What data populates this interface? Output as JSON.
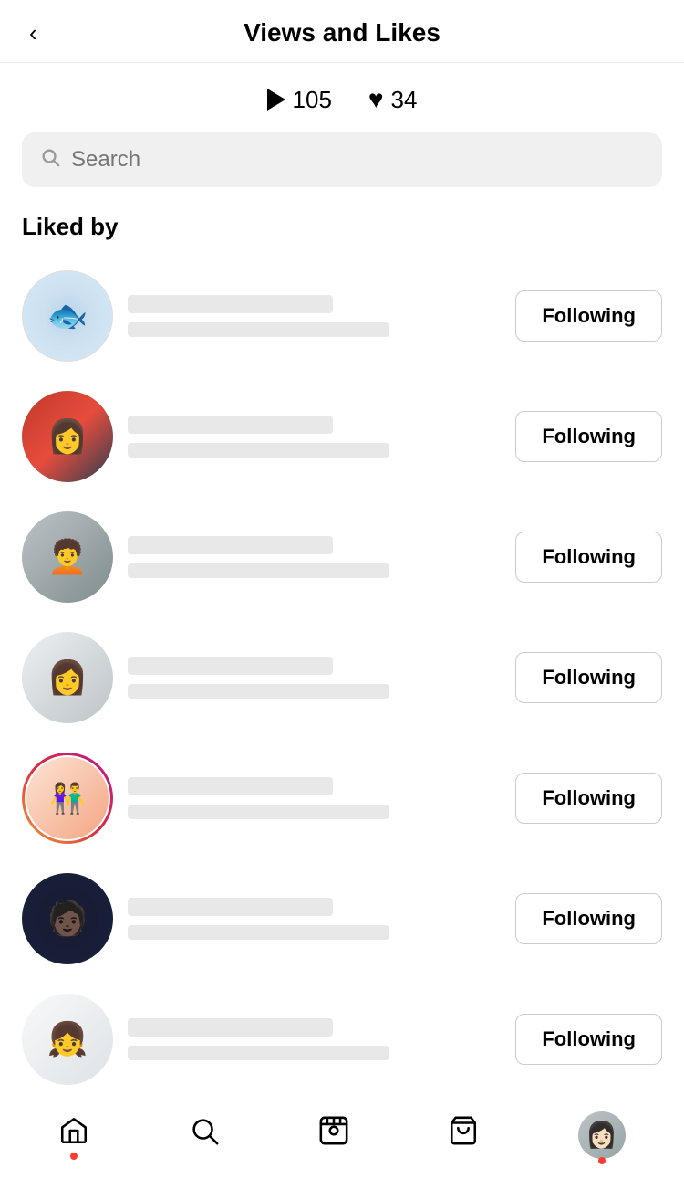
{
  "header": {
    "title": "Views and Likes",
    "back_label": "<"
  },
  "stats": {
    "views_count": "105",
    "likes_count": "34"
  },
  "search": {
    "placeholder": "Search"
  },
  "section": {
    "title": "Liked by"
  },
  "users": [
    {
      "id": 1,
      "following_label": "Following",
      "avatar_type": "fish",
      "has_story": false
    },
    {
      "id": 2,
      "following_label": "Following",
      "avatar_type": "girl1",
      "has_story": false
    },
    {
      "id": 3,
      "following_label": "Following",
      "avatar_type": "glasses",
      "has_story": false
    },
    {
      "id": 4,
      "following_label": "Following",
      "avatar_type": "jacket",
      "has_story": false
    },
    {
      "id": 5,
      "following_label": "Following",
      "avatar_type": "couple",
      "has_story": true
    },
    {
      "id": 6,
      "following_label": "Following",
      "avatar_type": "dark",
      "has_story": false
    },
    {
      "id": 7,
      "following_label": "Following",
      "avatar_type": "girl2",
      "has_story": false
    }
  ],
  "bottom_nav": {
    "home_label": "home",
    "search_label": "search",
    "reels_label": "reels",
    "shop_label": "shop",
    "profile_label": "profile"
  }
}
